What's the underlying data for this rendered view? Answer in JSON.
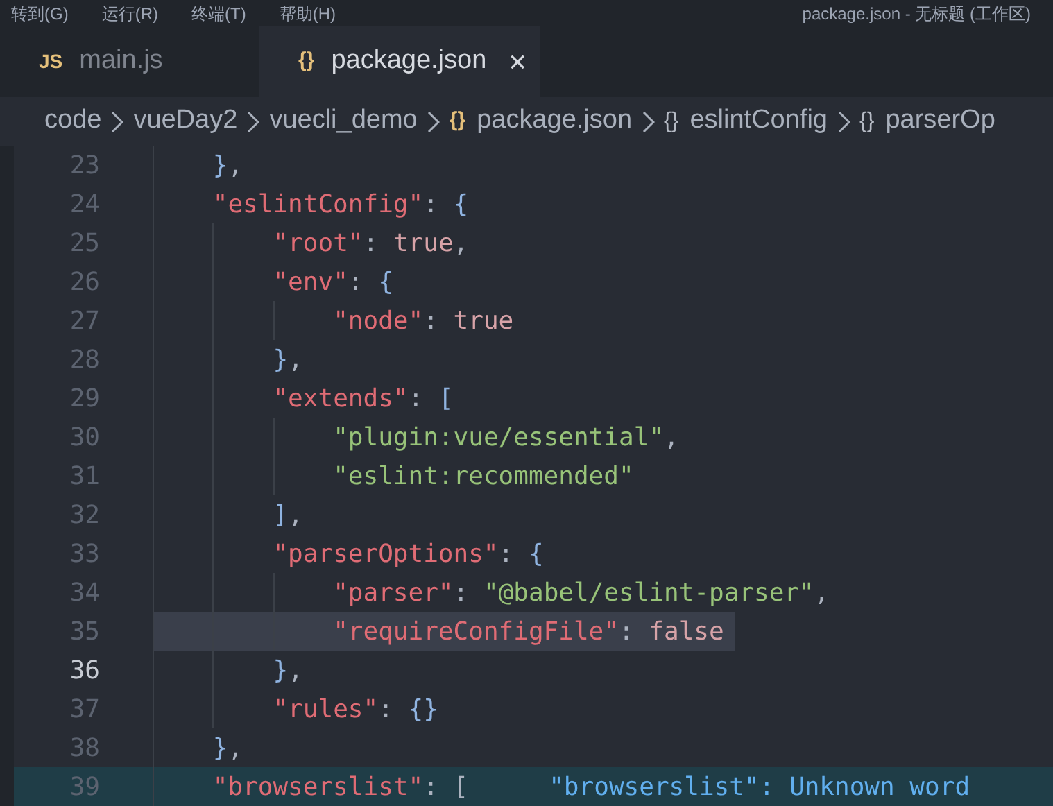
{
  "menu_bar": {
    "items": [
      "转到(G)",
      "运行(R)",
      "终端(T)",
      "帮助(H)"
    ],
    "title": "package.json - 无标题 (工作区)"
  },
  "tabs": [
    {
      "icon": "JS",
      "kind": "js",
      "label": "main.js",
      "selected": false
    },
    {
      "icon": "{}",
      "kind": "json",
      "label": "package.json",
      "selected": true,
      "close": "×"
    }
  ],
  "breadcrumbs": [
    {
      "label": "code"
    },
    {
      "label": "vueDay2"
    },
    {
      "label": "vuecli_demo"
    },
    {
      "icon": "{}",
      "kind": "json",
      "label": "package.json"
    },
    {
      "icon": "{}",
      "kind": "obj",
      "label": "eslintConfig"
    },
    {
      "icon": "{}",
      "kind": "obj",
      "label": "parserOp"
    }
  ],
  "lines": [
    {
      "number": "23",
      "current": false,
      "highlighted": false,
      "tokens": [
        {
          "kind": "bracket",
          "text": "}"
        },
        {
          "kind": "punct",
          "text": ","
        }
      ]
    },
    {
      "number": "24",
      "current": false,
      "highlighted": false,
      "tokens": [
        {
          "kind": "key",
          "text": "\"eslintConfig\""
        },
        {
          "kind": "punct",
          "text": ": "
        },
        {
          "kind": "bracket",
          "text": "{"
        }
      ]
    },
    {
      "number": "25",
      "current": false,
      "highlighted": false,
      "tokens": [
        {
          "kind": "key",
          "text": "\"root\""
        },
        {
          "kind": "punct",
          "text": ": "
        },
        {
          "kind": "bool",
          "text": "true"
        },
        {
          "kind": "punct",
          "text": ","
        }
      ]
    },
    {
      "number": "26",
      "current": false,
      "highlighted": false,
      "tokens": [
        {
          "kind": "key",
          "text": "\"env\""
        },
        {
          "kind": "punct",
          "text": ": "
        },
        {
          "kind": "bracket",
          "text": "{"
        }
      ]
    },
    {
      "number": "27",
      "current": false,
      "highlighted": false,
      "tokens": [
        {
          "kind": "key",
          "text": "\"node\""
        },
        {
          "kind": "punct",
          "text": ": "
        },
        {
          "kind": "bool",
          "text": "true"
        }
      ]
    },
    {
      "number": "28",
      "current": false,
      "highlighted": false,
      "tokens": [
        {
          "kind": "bracket",
          "text": "}"
        },
        {
          "kind": "punct",
          "text": ","
        }
      ]
    },
    {
      "number": "29",
      "current": false,
      "highlighted": false,
      "tokens": [
        {
          "kind": "key",
          "text": "\"extends\""
        },
        {
          "kind": "punct",
          "text": ": "
        },
        {
          "kind": "bracket",
          "text": "["
        }
      ]
    },
    {
      "number": "30",
      "current": false,
      "highlighted": false,
      "tokens": [
        {
          "kind": "string",
          "text": "\"plugin:vue/essential\""
        },
        {
          "kind": "punct",
          "text": ","
        }
      ]
    },
    {
      "number": "31",
      "current": false,
      "highlighted": false,
      "tokens": [
        {
          "kind": "string",
          "text": "\"eslint:recommended\""
        }
      ]
    },
    {
      "number": "32",
      "current": false,
      "highlighted": false,
      "tokens": [
        {
          "kind": "bracket",
          "text": "]"
        },
        {
          "kind": "punct",
          "text": ","
        }
      ]
    },
    {
      "number": "33",
      "current": false,
      "highlighted": false,
      "tokens": [
        {
          "kind": "key",
          "text": "\"parserOptions\""
        },
        {
          "kind": "punct",
          "text": ": "
        },
        {
          "kind": "bracket",
          "text": "{"
        }
      ]
    },
    {
      "number": "34",
      "current": false,
      "highlighted": false,
      "tokens": [
        {
          "kind": "key",
          "text": "\"parser\""
        },
        {
          "kind": "punct",
          "text": ": "
        },
        {
          "kind": "string",
          "text": "\"@babel/eslint-parser\""
        },
        {
          "kind": "punct",
          "text": ","
        }
      ]
    },
    {
      "number": "35",
      "current": false,
      "highlighted": true,
      "tokens": [
        {
          "kind": "key",
          "text": "\"requireConfigFile\""
        },
        {
          "kind": "punct",
          "text": ": "
        },
        {
          "kind": "bool",
          "text": "false"
        }
      ]
    },
    {
      "number": "36",
      "current": true,
      "highlighted": false,
      "tokens": [
        {
          "kind": "bracket",
          "text": "}"
        },
        {
          "kind": "punct",
          "text": ","
        }
      ]
    },
    {
      "number": "37",
      "current": false,
      "highlighted": false,
      "tokens": [
        {
          "kind": "key",
          "text": "\"rules\""
        },
        {
          "kind": "punct",
          "text": ": "
        },
        {
          "kind": "bracket",
          "text": "{}"
        }
      ]
    },
    {
      "number": "38",
      "current": false,
      "highlighted": false,
      "tokens": [
        {
          "kind": "bracket",
          "text": "}"
        },
        {
          "kind": "punct",
          "text": ","
        }
      ]
    },
    {
      "number": "39",
      "current": false,
      "highlighted": false,
      "error": true,
      "tokens": [
        {
          "kind": "key",
          "text": "\"browserslist\""
        },
        {
          "kind": "punct",
          "text": ": ["
        },
        {
          "kind": "hint",
          "text": "\"browserslist\": Unknown word"
        }
      ]
    }
  ]
}
